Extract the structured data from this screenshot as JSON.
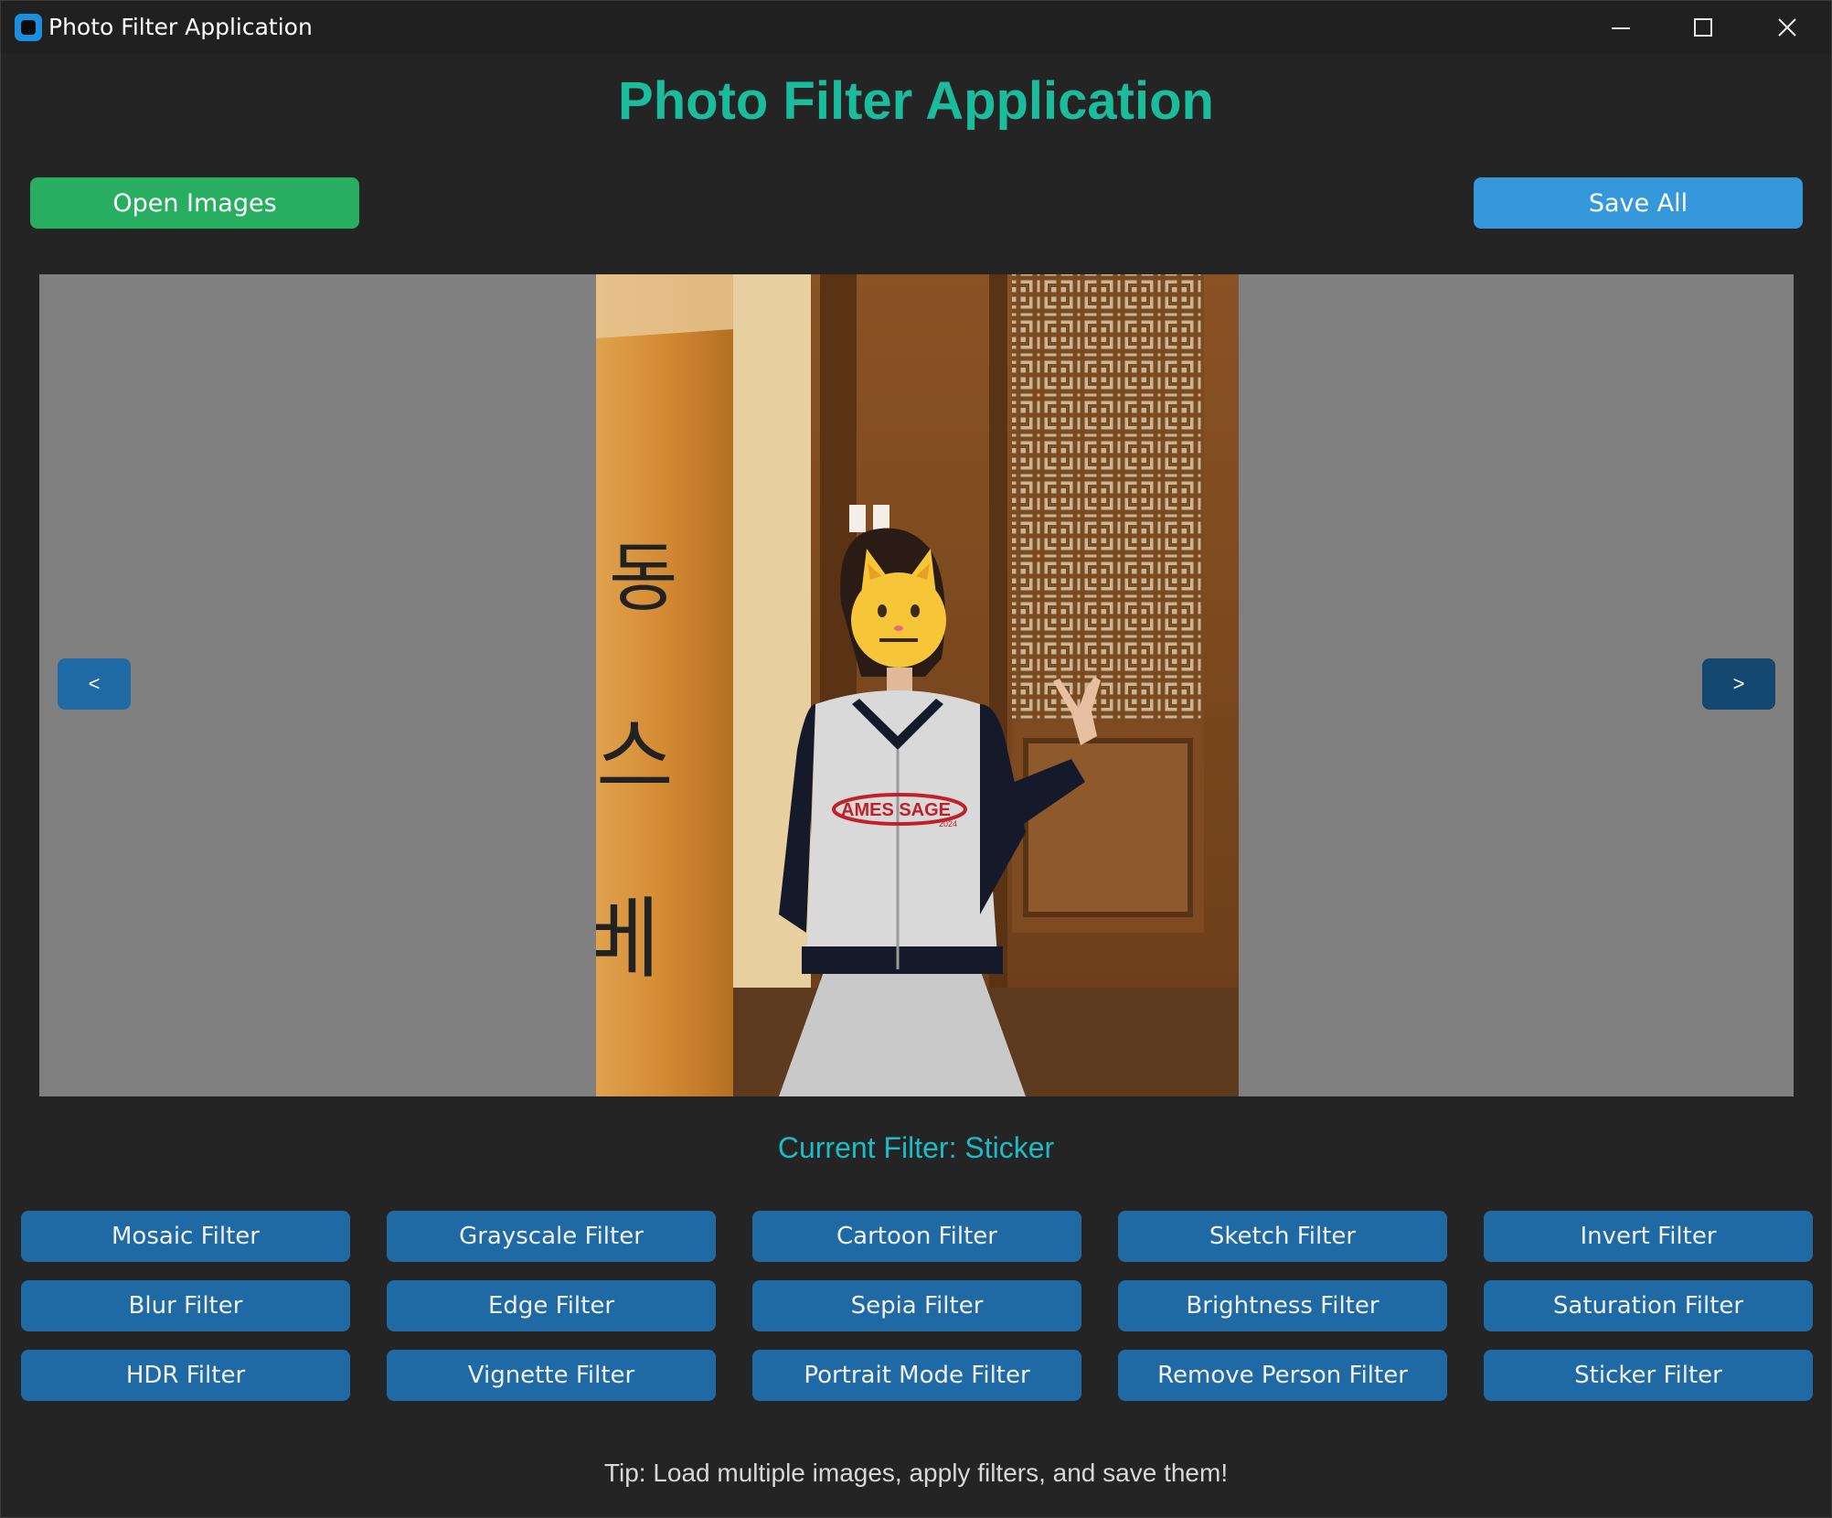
{
  "window": {
    "title": "Photo Filter Application"
  },
  "header": {
    "title": "Photo Filter Application",
    "open_label": "Open Images",
    "save_label": "Save All"
  },
  "viewer": {
    "prev_label": "<",
    "next_label": ">",
    "photo_text": {
      "sign_chars": [
        "동",
        "스",
        "베"
      ],
      "shirt_text": "AMES SAGE",
      "shirt_year": "2024"
    }
  },
  "status": {
    "current_filter": "Current Filter: Sticker"
  },
  "filters": [
    [
      "Mosaic Filter",
      "Grayscale Filter",
      "Cartoon Filter",
      "Sketch Filter",
      "Invert Filter"
    ],
    [
      "Blur Filter",
      "Edge Filter",
      "Sepia Filter",
      "Brightness Filter",
      "Saturation Filter"
    ],
    [
      "HDR Filter",
      "Vignette Filter",
      "Portrait Mode Filter",
      "Remove Person Filter",
      "Sticker Filter"
    ]
  ],
  "footer": {
    "tip": "Tip: Load multiple images, apply filters, and save them!"
  },
  "colors": {
    "title": "#1abc9c",
    "open_button": "#27ae60",
    "save_button": "#3498db",
    "filter_button": "#1f6aa5",
    "viewer_bg": "#808080"
  }
}
